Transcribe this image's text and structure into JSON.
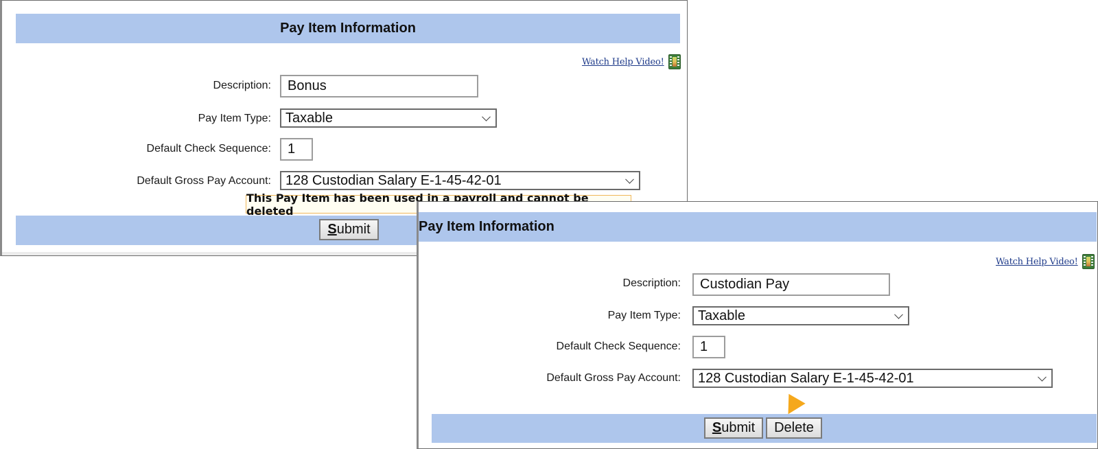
{
  "panel_a": {
    "title": "Pay Item Information",
    "help_link": "Watch Help Video!",
    "help_icon": "film-icon",
    "fields": {
      "description_label": "Description:",
      "description_value": "Bonus",
      "pay_item_type_label": "Pay Item Type:",
      "pay_item_type_value": "Taxable",
      "check_sequence_label": "Default Check Sequence:",
      "check_sequence_value": "1",
      "gross_pay_account_label": "Default Gross Pay Account:",
      "gross_pay_account_value": "128 Custodian Salary E-1-45-42-01"
    },
    "warning": "This Pay Item has been used in a payroll and cannot be deleted",
    "submit_hotkey": "S",
    "submit_rest": "ubmit"
  },
  "panel_b": {
    "title": "Pay Item Information",
    "help_link": "Watch Help Video!",
    "help_icon": "film-icon",
    "fields": {
      "description_label": "Description:",
      "description_value": "Custodian Pay",
      "pay_item_type_label": "Pay Item Type:",
      "pay_item_type_value": "Taxable",
      "check_sequence_label": "Default Check Sequence:",
      "check_sequence_value": "1",
      "gross_pay_account_label": "Default Gross Pay Account:",
      "gross_pay_account_value": "128 Custodian Salary E-1-45-42-01"
    },
    "submit_hotkey": "S",
    "submit_rest": "ubmit",
    "delete_label": "Delete",
    "callout_icon": "pointer-arrow-icon"
  },
  "colors": {
    "header_bg": "#aec6ec",
    "warning_border": "#f0b75a",
    "callout_arrow": "#f5a81c"
  }
}
